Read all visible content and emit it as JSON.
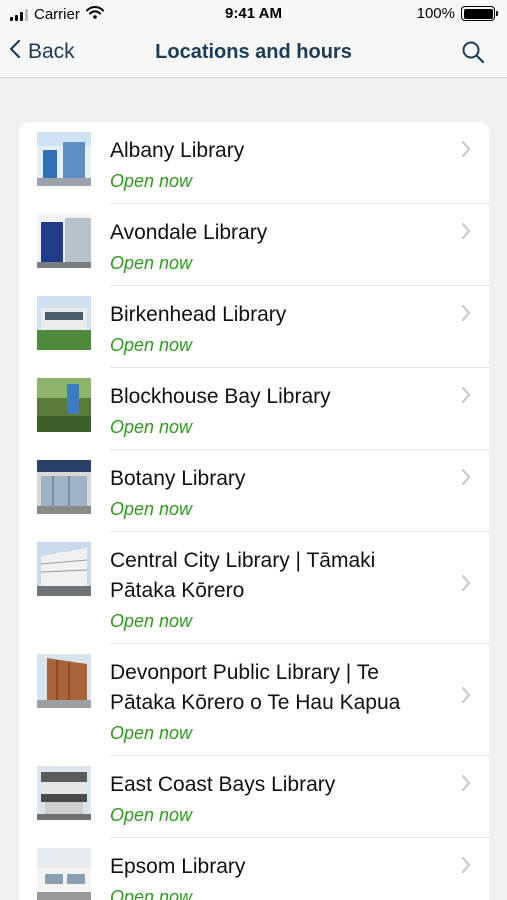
{
  "status": {
    "carrier": "Carrier",
    "time": "9:41 AM",
    "battery": "100%"
  },
  "nav": {
    "back_label": "Back",
    "title": "Locations and hours"
  },
  "colors": {
    "accent": "#1b3d57",
    "open_status": "#2e9a1e",
    "background": "#efeff4"
  },
  "libraries": [
    {
      "name": "Albany Library",
      "status": "Open now"
    },
    {
      "name": "Avondale Library",
      "status": "Open now"
    },
    {
      "name": "Birkenhead Library",
      "status": "Open now"
    },
    {
      "name": "Blockhouse Bay Library",
      "status": "Open now"
    },
    {
      "name": "Botany Library",
      "status": "Open now"
    },
    {
      "name": "Central City Library | Tāmaki Pātaka Kōrero",
      "status": "Open now"
    },
    {
      "name": "Devonport Public Library | Te Pātaka Kōrero o Te Hau Kapua",
      "status": "Open now"
    },
    {
      "name": "East Coast Bays Library",
      "status": "Open now"
    },
    {
      "name": "Epsom Library",
      "status": "Open now"
    }
  ]
}
